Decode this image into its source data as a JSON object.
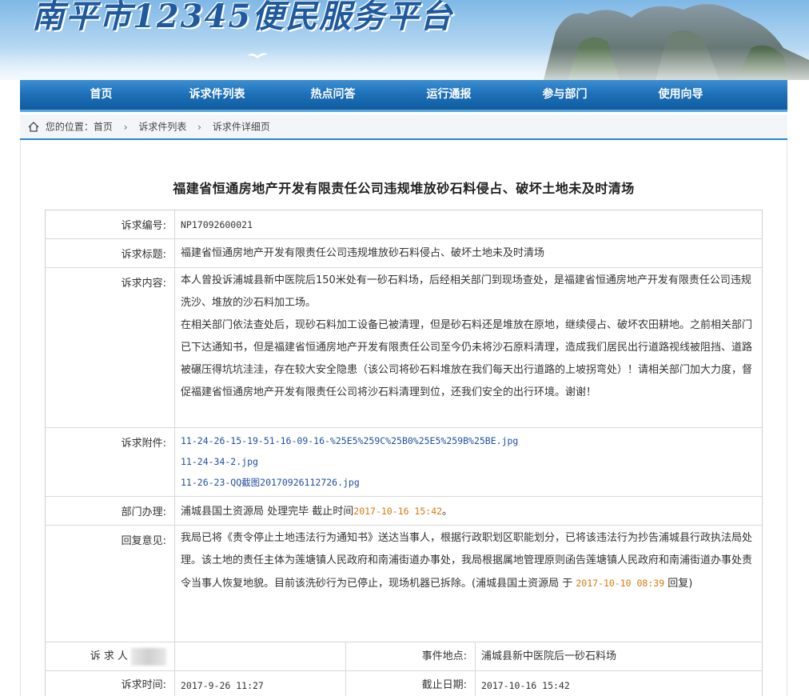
{
  "header": {
    "site_title": "南平市12345便民服务平台"
  },
  "nav": {
    "items": [
      "首页",
      "诉求件列表",
      "热点问答",
      "运行通报",
      "参与部门",
      "使用向导"
    ]
  },
  "breadcrumb": {
    "prefix": "您的位置：",
    "items": [
      "首页",
      "诉求件列表",
      "诉求件详细页"
    ]
  },
  "page": {
    "title": "福建省恒通房地产开发有限责任公司违规堆放砂石料侵占、破坏土地未及时清场"
  },
  "detail": {
    "id_label": "诉求编号:",
    "id_value": "NP17092600021",
    "title_label": "诉求标题:",
    "title_value": "福建省恒通房地产开发有限责任公司违规堆放砂石料侵占、破坏土地未及时清场",
    "content_label": "诉求内容:",
    "content_p1": "本人曾投诉浦城县新中医院后150米处有一砂石料场，后经相关部门到现场查处，是福建省恒通房地产开发有限责任公司违规洗沙、堆放的沙石料加工场。",
    "content_p2": "在相关部门依法查处后，现砂石料加工设备已被清理，但是砂石料还是堆放在原地，继续侵占、破坏农田耕地。之前相关部门已下达通知书，但是福建省恒通房地产开发有限责任公司至今仍未将沙石原料清理，造成我们居民出行道路视线被阻挡、道路被碾压得坑坑洼洼，存在较大安全隐患（该公司将砂石料堆放在我们每天出行道路的上坡拐弯处）！请相关部门加大力度，督促福建省恒通房地产开发有限责任公司将沙石料清理到位，还我们安全的出行环境。谢谢！",
    "attach_label": "诉求附件:",
    "attachments": [
      "11-24-26-15-19-51-16-09-16-%25E5%259C%25B0%25E5%259B%25BE.jpg",
      "11-24-34-2.jpg",
      "11-26-23-QQ截图20170926112726.jpg"
    ],
    "dept_label": "部门办理:",
    "dept_text": "浦城县国土资源局 处理完毕 截止时间",
    "dept_deadline": "2017-10-16 15:42",
    "dept_suffix": "。",
    "reply_label": "回复意见:",
    "reply_text": "我局已将《责令停止土地违法行为通知书》送达当事人，根据行政职划区职能划分，已将该违法行为抄告浦城县行政执法局处理。该土地的责任主体为莲塘镇人民政府和南浦街道办事处，我局根据属地管理原则函告莲塘镇人民政府和南浦街道办事处责令当事人恢复地貌。目前该洗砂行为已停止，现场机器已拆除。(浦城县国土资源局 于 ",
    "reply_time": "2017-10-10 08:39",
    "reply_suffix": " 回复)",
    "requester_label": "诉 求 人",
    "location_label": "事件地点:",
    "location_value": "浦城县新中医院后一砂石料场",
    "time_label": "诉求时间:",
    "time_value": "2017-9-26 11:27",
    "deadline_label": "截止日期:",
    "deadline_value": "2017-10-16 15:42"
  },
  "colors": {
    "nav_blue": "#1d6fb8",
    "accent_orange": "#d47a0e",
    "link_blue": "#1f4fa0"
  }
}
